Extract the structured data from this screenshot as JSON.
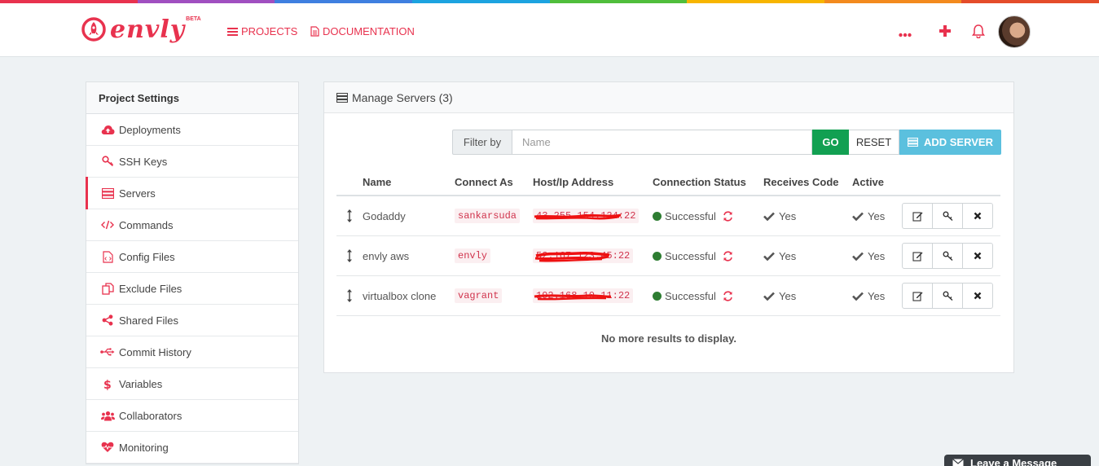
{
  "brand": {
    "name": "envly",
    "badge": "BETA",
    "rainbow": [
      "#e8324e",
      "#a04fc0",
      "#3f7fe0",
      "#1ca3e0",
      "#50be3c",
      "#f7b500",
      "#f38a1e",
      "#e44c2a"
    ]
  },
  "nav": {
    "projects": "PROJECTS",
    "documentation": "DOCUMENTATION"
  },
  "sidebar": {
    "title": "Project Settings",
    "items": [
      {
        "label": "Deployments",
        "icon": "cloud-upload-icon"
      },
      {
        "label": "SSH Keys",
        "icon": "key-icon"
      },
      {
        "label": "Servers",
        "icon": "server-icon",
        "active": true
      },
      {
        "label": "Commands",
        "icon": "code-icon"
      },
      {
        "label": "Config Files",
        "icon": "file-code-icon"
      },
      {
        "label": "Exclude Files",
        "icon": "copy-icon"
      },
      {
        "label": "Shared Files",
        "icon": "share-icon"
      },
      {
        "label": "Commit History",
        "icon": "usb-icon"
      },
      {
        "label": "Variables",
        "icon": "dollar-icon"
      },
      {
        "label": "Collaborators",
        "icon": "users-icon"
      },
      {
        "label": "Monitoring",
        "icon": "heartbeat-icon"
      }
    ]
  },
  "panel": {
    "title": "Manage Servers (3)",
    "filter_label": "Filter by",
    "filter_placeholder": "Name",
    "go": "GO",
    "reset": "RESET",
    "add": "ADD SERVER",
    "columns": [
      "Name",
      "Connect As",
      "Host/Ip Address",
      "Connection Status",
      "Receives Code",
      "Active"
    ],
    "rows": [
      {
        "name": "Godaddy",
        "user": "sankarsuda",
        "host": "43.255.154.124:22",
        "status": "Successful",
        "receives": "Yes",
        "active": "Yes"
      },
      {
        "name": "envly aws",
        "user": "envly",
        "host": "52.167.123.45:22",
        "status": "Successful",
        "receives": "Yes",
        "active": "Yes"
      },
      {
        "name": "virtualbox clone",
        "user": "vagrant",
        "host": "192.168.10.11:22",
        "status": "Successful",
        "receives": "Yes",
        "active": "Yes"
      }
    ],
    "empty": "No more results to display."
  },
  "chat": {
    "label": "Leave a Message"
  }
}
